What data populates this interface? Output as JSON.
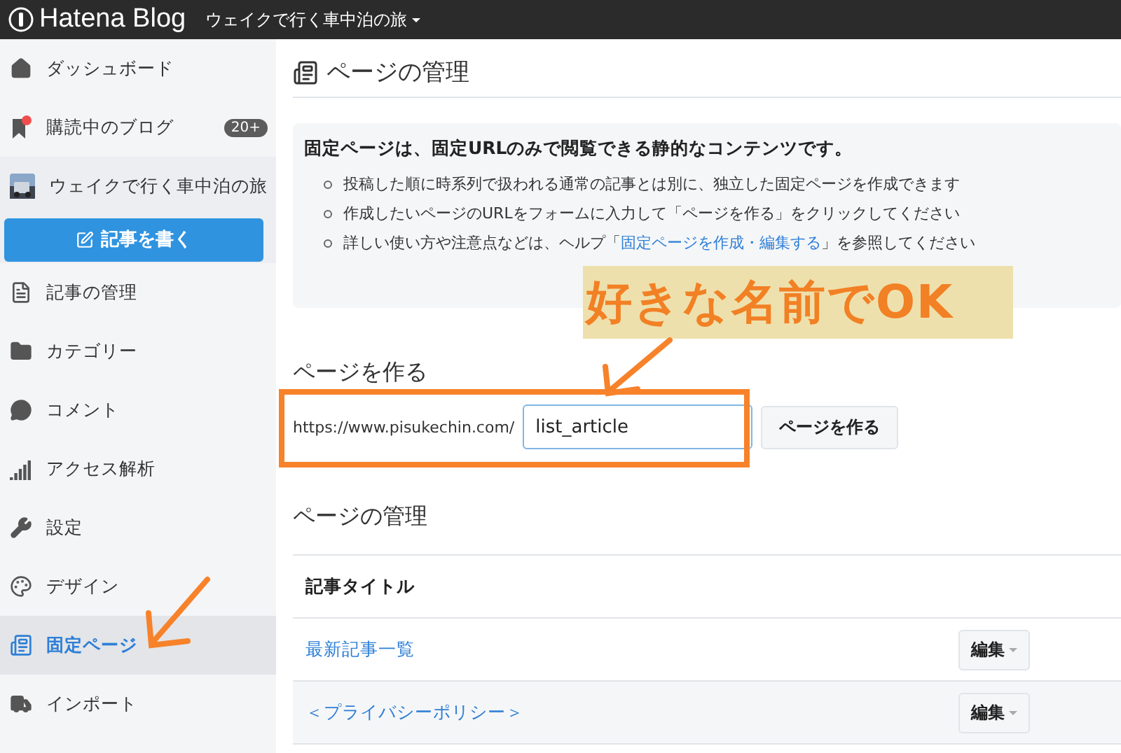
{
  "topbar": {
    "logo": "Hatena Blog",
    "blog_menu": "ウェイクで行く車中泊の旅"
  },
  "sidebar": {
    "items": [
      {
        "kind": "home",
        "label": "ダッシュボード",
        "selected": false
      },
      {
        "kind": "bookmark",
        "label": "購読中のブログ",
        "badge": "20+",
        "selected": false
      },
      {
        "kind": "blog",
        "label": "ウェイクで行く車中泊の旅",
        "selected": false
      },
      {
        "kind": "articles",
        "label": "記事の管理",
        "selected": false
      },
      {
        "kind": "folder",
        "label": "カテゴリー",
        "selected": false
      },
      {
        "kind": "comment",
        "label": "コメント",
        "selected": false
      },
      {
        "kind": "stats",
        "label": "アクセス解析",
        "selected": false
      },
      {
        "kind": "settings",
        "label": "設定",
        "selected": false
      },
      {
        "kind": "design",
        "label": "デザイン",
        "selected": false
      },
      {
        "kind": "pages",
        "label": "固定ページ",
        "selected": true
      },
      {
        "kind": "import",
        "label": "インポート",
        "selected": false
      }
    ],
    "write_button": "記事を書く"
  },
  "main": {
    "title": "ページの管理",
    "info": {
      "heading": "固定ページは、固定URLのみで閲覧できる静的なコンテンツです。",
      "bullets": [
        {
          "text": "投稿した順に時系列で扱われる通常の記事とは別に、独立した固定ページを作成できます"
        },
        {
          "text": "作成したいページのURLをフォームに入力して「ページを作る」をクリックしてください"
        },
        {
          "text": "詳しい使い方や注意点などは、ヘルプ「",
          "link": "固定ページを作成・編集する",
          "after": "」を参照してください"
        }
      ]
    },
    "create": {
      "heading": "ページを作る",
      "url_prefix": "https://www.pisukechin.com/",
      "value": "list_article",
      "button": "ページを作る"
    },
    "list": {
      "heading": "ページの管理",
      "column": "記事タイトル",
      "rows": [
        {
          "title": "最新記事一覧",
          "action": "編集"
        },
        {
          "title": "＜プライバシーポリシー＞",
          "action": "編集"
        }
      ]
    }
  },
  "annotation": {
    "callout": "好きな名前でOK"
  }
}
